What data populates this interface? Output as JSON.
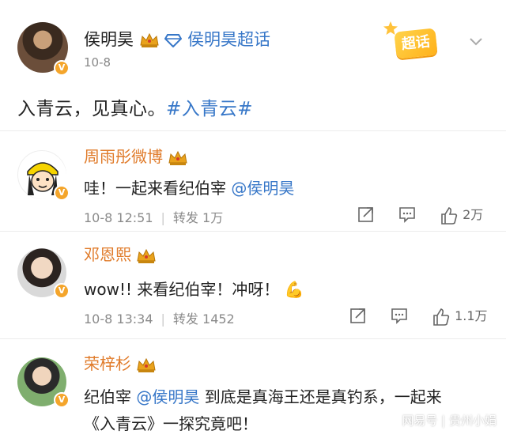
{
  "post": {
    "author": "侯明昊",
    "super_topic_label": "侯明昊超话",
    "date": "10-8",
    "text": "入青云，见真心。",
    "hashtag": "#入青云#",
    "super_badge": "超话"
  },
  "comments": [
    {
      "name": "周雨彤微博",
      "text": "哇！一起来看纪伯宰",
      "mention": "@侯明昊",
      "time": "10-8 12:51",
      "repost_label": "转发",
      "repost_count": "1万",
      "like_count": "2万"
    },
    {
      "name": "邓恩熙",
      "text": "wow!! 来看纪伯宰！冲呀！",
      "emoji": "💪",
      "time": "10-8 13:34",
      "repost_label": "转发",
      "repost_count": "1452",
      "like_count": "1.1万"
    },
    {
      "name": "荣梓杉",
      "text_before": "纪伯宰",
      "mention": "@侯明昊",
      "text_after": "到底是真海王还是真钓系，一起来",
      "text_line2": "《入青云》一探究竟吧！"
    }
  ],
  "watermark": "网易号 | 贵州小娟",
  "colors": {
    "link": "#3777c8",
    "comment_name": "#e07b2a",
    "badge": "#f4a52b"
  }
}
